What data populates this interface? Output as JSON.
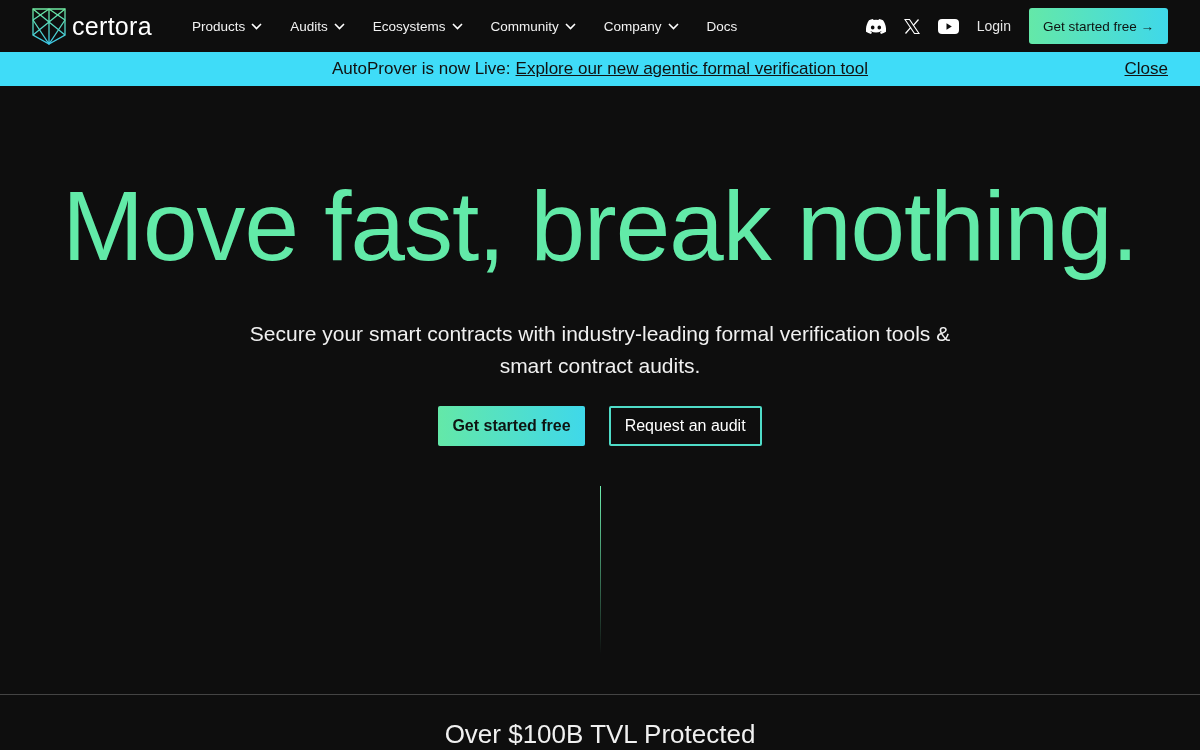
{
  "header": {
    "logo": "certora",
    "nav": [
      {
        "label": "Products",
        "dropdown": true
      },
      {
        "label": "Audits",
        "dropdown": true
      },
      {
        "label": "Ecosystems",
        "dropdown": true
      },
      {
        "label": "Community",
        "dropdown": true
      },
      {
        "label": "Company",
        "dropdown": true
      },
      {
        "label": "Docs",
        "dropdown": false
      }
    ],
    "social": [
      {
        "kind": "discord"
      },
      {
        "kind": "x"
      },
      {
        "kind": "youtube"
      }
    ],
    "login": "Login",
    "cta": "Get started free →"
  },
  "banner": {
    "text": "AutoProver is now Live:",
    "link": "Explore our new agentic formal verification tool",
    "close": "Close"
  },
  "hero": {
    "title": "Move fast, break nothing.",
    "subtitle": "Secure your smart contracts with industry-leading formal verification tools & smart contract audits.",
    "buttons": [
      {
        "label": "Get started free",
        "kind": "primary"
      },
      {
        "label": "Request an audit",
        "kind": "outline"
      }
    ]
  },
  "stats": {
    "heading": "Over $100B TVL Protected"
  }
}
